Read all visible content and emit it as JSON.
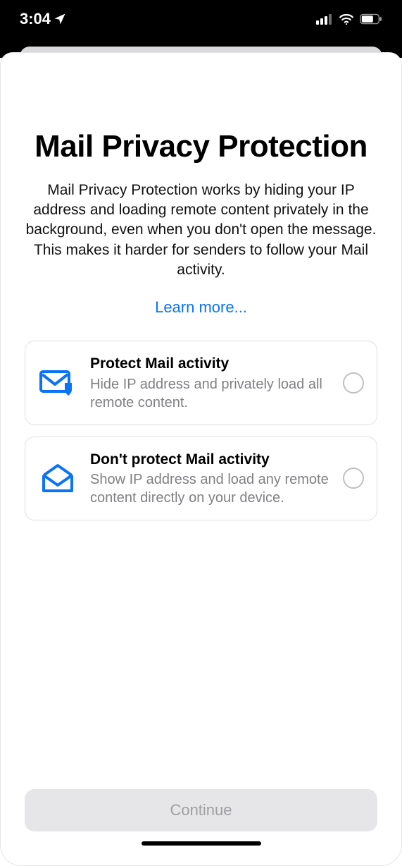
{
  "status": {
    "time": "3:04"
  },
  "sheet": {
    "title": "Mail Privacy Protection",
    "description": "Mail Privacy Protection works by hiding your IP address and loading remote content privately in the background, even when you don't open the message. This makes it harder for senders to follow your Mail activity.",
    "learn_more": "Learn more..."
  },
  "options": {
    "protect": {
      "title": "Protect Mail activity",
      "subtitle": "Hide IP address and privately load all remote content."
    },
    "dont_protect": {
      "title": "Don't protect Mail activity",
      "subtitle": "Show IP address and load any remote content directly on your device."
    }
  },
  "footer": {
    "continue_label": "Continue"
  }
}
